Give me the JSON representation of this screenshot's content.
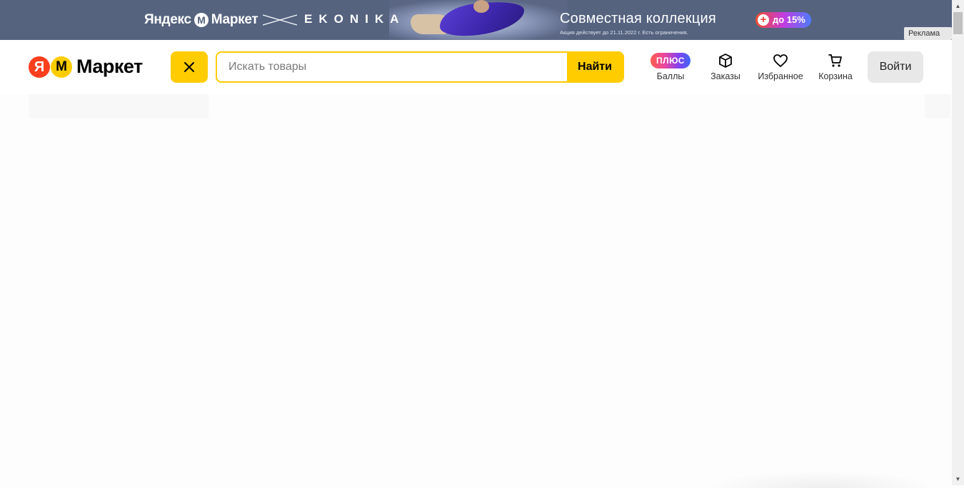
{
  "banner": {
    "brand": "Яндекс",
    "brand_market": "Маркет",
    "brand_icon": "market-m-logo-icon",
    "partner": "EKONIKA",
    "title": "Совместная коллекция",
    "note": "Акция действует до 21.11.2022 г. Есть ограничения.",
    "discount": "до 15%",
    "ad_label": "Реклама",
    "ad_menu_icon": "more-vertical-icon",
    "bg_color": "#55637f"
  },
  "header": {
    "logo_ya": "Я",
    "logo_text": "Маркет",
    "catalog_icon": "close-icon",
    "search": {
      "placeholder": "Искать товары",
      "value": "",
      "button_label": "Найти"
    },
    "nav": {
      "plus_badge": "ПЛЮС",
      "points_label": "Баллы",
      "orders_label": "Заказы",
      "orders_icon": "box-icon",
      "favorites_label": "Избранное",
      "favorites_icon": "heart-icon",
      "cart_label": "Корзина",
      "cart_icon": "cart-icon"
    },
    "login_label": "Войти"
  },
  "colors": {
    "accent": "#ffcc00",
    "logo_red": "#fc3f1d",
    "login_bg": "#e8e8e8"
  }
}
